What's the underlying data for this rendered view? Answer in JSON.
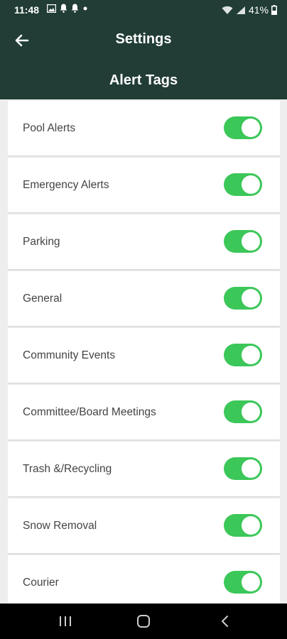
{
  "status_bar": {
    "time": "11:48",
    "left_icons": [
      "image-icon",
      "bell-icon",
      "bell-icon",
      "dot-icon"
    ],
    "battery": "41%"
  },
  "header": {
    "title": "Settings",
    "subtitle": "Alert Tags",
    "background_color": "#213d35"
  },
  "alert_tags": [
    {
      "label": "Pool Alerts",
      "enabled": true
    },
    {
      "label": "Emergency Alerts",
      "enabled": true
    },
    {
      "label": "Parking",
      "enabled": true
    },
    {
      "label": "General",
      "enabled": true
    },
    {
      "label": "Community Events",
      "enabled": true
    },
    {
      "label": "Committee/Board Meetings",
      "enabled": true
    },
    {
      "label": "Trash &/Recycling",
      "enabled": true
    },
    {
      "label": "Snow Removal",
      "enabled": true
    },
    {
      "label": "Courier",
      "enabled": true
    }
  ],
  "colors": {
    "toggle_on": "#3cc759",
    "row_text": "#444444"
  },
  "navbar": {
    "buttons": [
      "recents-icon",
      "home-icon",
      "back-icon"
    ]
  }
}
